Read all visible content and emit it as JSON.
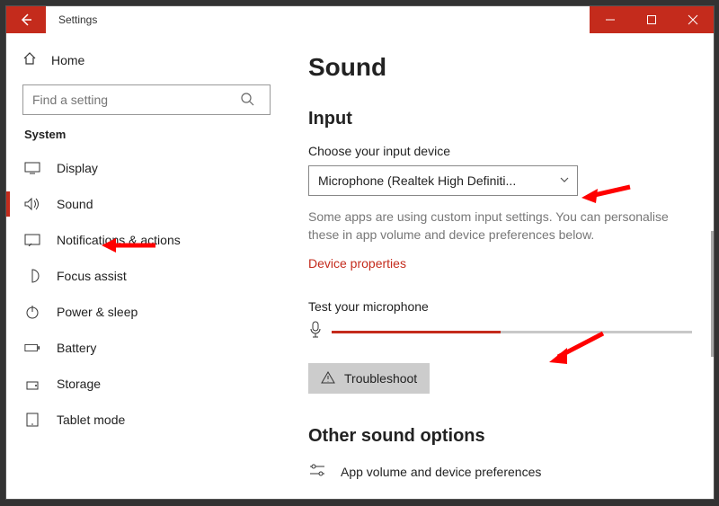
{
  "titlebar": {
    "title": "Settings"
  },
  "sidebar": {
    "home": "Home",
    "search_placeholder": "Find a setting",
    "section": "System",
    "items": [
      {
        "label": "Display"
      },
      {
        "label": "Sound"
      },
      {
        "label": "Notifications & actions"
      },
      {
        "label": "Focus assist"
      },
      {
        "label": "Power & sleep"
      },
      {
        "label": "Battery"
      },
      {
        "label": "Storage"
      },
      {
        "label": "Tablet mode"
      }
    ]
  },
  "main": {
    "heading": "Sound",
    "input_heading": "Input",
    "choose_label": "Choose your input device",
    "choose_value": "Microphone (Realtek High Definiti...",
    "note": "Some apps are using custom input settings. You can personalise these in app volume and device preferences below.",
    "device_properties": "Device properties",
    "test_label": "Test your microphone",
    "mic_level_pct": 47,
    "troubleshoot": "Troubleshoot",
    "other_heading": "Other sound options",
    "other_item": "App volume and device preferences"
  },
  "colors": {
    "accent": "#c42b1c"
  }
}
